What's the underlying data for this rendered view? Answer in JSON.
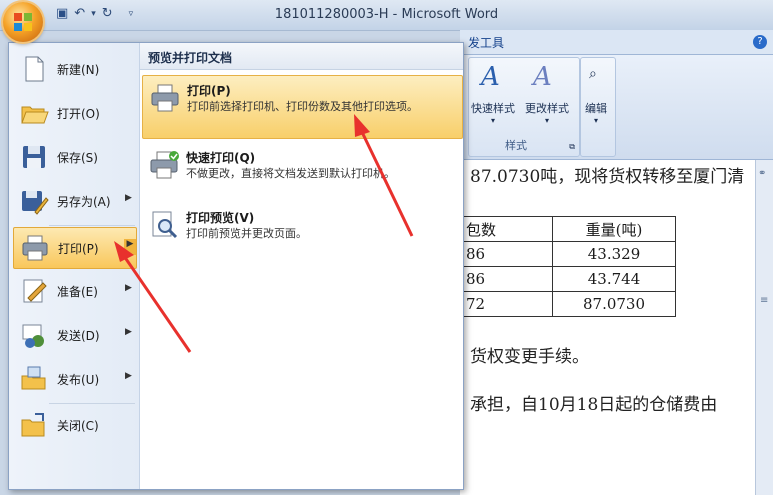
{
  "window": {
    "title": "181011280003-H - Microsoft Word"
  },
  "qat": {
    "save": "💾",
    "undo": "↶",
    "redo": "↻",
    "customize": "▾"
  },
  "ribbon": {
    "tab_label": "发工具",
    "style_btn1": "快速样式",
    "style_btn2": "更改样式",
    "style_group": "样式",
    "edit_btn": "编辑",
    "help": "?"
  },
  "document": {
    "line1": "87.0730吨，现将货权转移至厦门清",
    "table": [
      [
        "包数",
        "重量(吨)"
      ],
      [
        "86",
        "43.329"
      ],
      [
        "86",
        "43.744"
      ],
      [
        "72",
        "87.0730"
      ]
    ],
    "line2": "货权变更手续。",
    "line3": "承担，自10月18日起的仓储费由"
  },
  "menu": {
    "left": [
      {
        "label": "新建(N)"
      },
      {
        "label": "打开(O)"
      },
      {
        "label": "保存(S)"
      },
      {
        "label": "另存为(A)"
      },
      {
        "label": "打印(P)"
      },
      {
        "label": "准备(E)"
      },
      {
        "label": "发送(D)"
      },
      {
        "label": "发布(U)"
      },
      {
        "label": "关闭(C)"
      }
    ],
    "submenu_header": "预览并打印文档",
    "sub": [
      {
        "title": "打印(P)",
        "desc": "打印前选择打印机、打印份数及其他打印选项。"
      },
      {
        "title": "快速打印(Q)",
        "desc": "不做更改，直接将文档发送到默认打印机。"
      },
      {
        "title": "打印预览(V)",
        "desc": "打印前预览并更改页面。"
      }
    ]
  },
  "colors": {
    "highlight": "#f9c75b",
    "arrow": "#e8312d",
    "accent": "#2b5fad"
  }
}
